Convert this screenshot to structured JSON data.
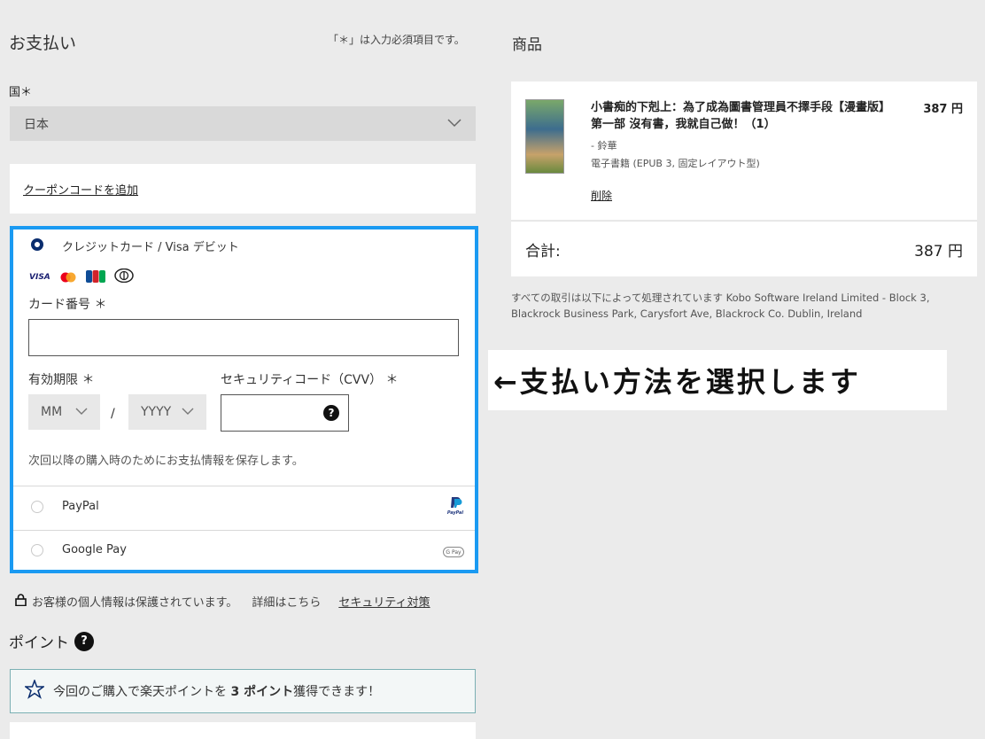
{
  "payment": {
    "title": "お支払い",
    "required_note": "「＊」は入力必須項目です。",
    "country_label": "国＊",
    "country_value": "日本",
    "coupon_link": "クーポンコードを追加"
  },
  "methods": {
    "credit": {
      "label": "クレジットカード / Visa デビット",
      "card_brands": [
        "VISA",
        "mastercard",
        "JCB",
        "Diners Club"
      ],
      "card_number_label": "カード番号 ＊",
      "expiry_label": "有効期限 ＊",
      "month_value": "MM",
      "slash": "/",
      "year_value": "YYYY",
      "cvv_label": "セキュリティコード（CVV） ＊",
      "save_note": "次回以降の購入時のためにお支払情報を保存します。"
    },
    "paypal": {
      "label": "PayPal",
      "logo_text": "PayPal"
    },
    "googlepay": {
      "label": "Google Pay",
      "logo_text": "G Pay"
    }
  },
  "privacy": {
    "text": "お客様の個人情報は保護されています。",
    "details_link": "詳細はこちら",
    "security_link": "セキュリティ対策"
  },
  "points": {
    "title": "ポイント",
    "message_pre": "今回のご購入で楽天ポイントを ",
    "message_points": "3 ポイント",
    "message_post": "獲得できます！"
  },
  "order": {
    "title": "商品",
    "product_title": "小書痴的下剋上：為了成為圖書管理員不擇手段【漫畫版】第一部 沒有書，我就自己做！（1）",
    "product_price": "387 円",
    "author": "- 鈴華",
    "format": "電子書籍 (EPUB 3, 固定レイアウト型)",
    "delete_link": "削除",
    "total_label": "合計:",
    "total_value": "387 円",
    "processing_note": "すべての取引は以下によって処理されています Kobo Software Ireland Limited - Block 3, Blackrock Business Park, Carysfort Ave, Blackrock Co. Dublin, Ireland"
  },
  "annotation": {
    "text": "←支払い方法を選択します"
  },
  "colors": {
    "highlight_border": "#1a9af2",
    "radio_checked": "#0a2d6e",
    "points_border": "#7bb0b3"
  }
}
